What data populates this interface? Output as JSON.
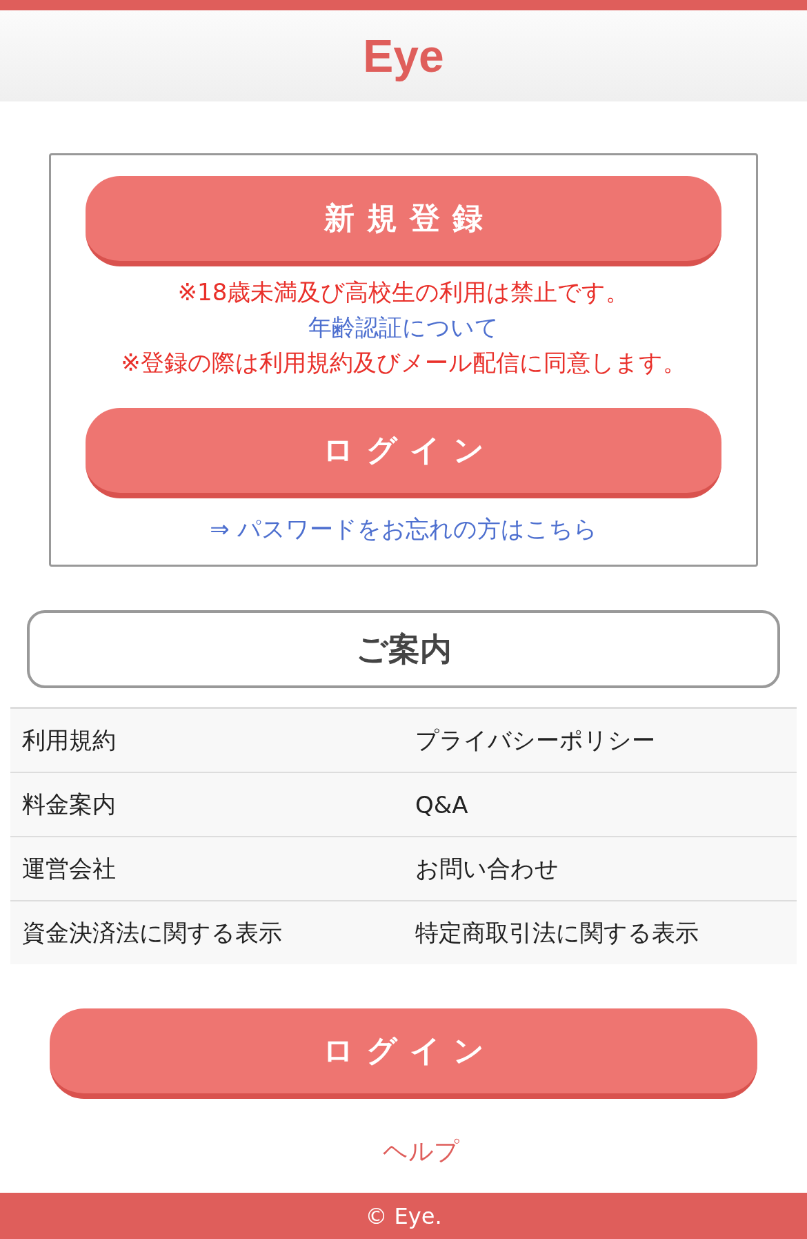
{
  "header": {
    "title": "Eye"
  },
  "auth": {
    "register_button": "新規登録",
    "notes": [
      {
        "kind": "warning",
        "text": "※18歳未満及び高校生の利用は禁止です。"
      },
      {
        "kind": "link",
        "text": "年齢認証について"
      },
      {
        "kind": "warning",
        "text": "※登録の際は利用規約及びメール配信に同意します。"
      }
    ],
    "login_button": "ログイン",
    "forgot_link": "⇒ パスワードをお忘れの方はこちら"
  },
  "guide": {
    "heading": "ご案内",
    "links": [
      [
        "利用規約",
        "プライバシーポリシー"
      ],
      [
        "料金案内",
        "Q&A"
      ],
      [
        "運営会社",
        "お問い合わせ"
      ],
      [
        "資金決済法に関する表示",
        "特定商取引法に関する表示"
      ]
    ]
  },
  "login_button": "ログイン",
  "help_link": "ヘルプ",
  "footer": "© Eye."
}
